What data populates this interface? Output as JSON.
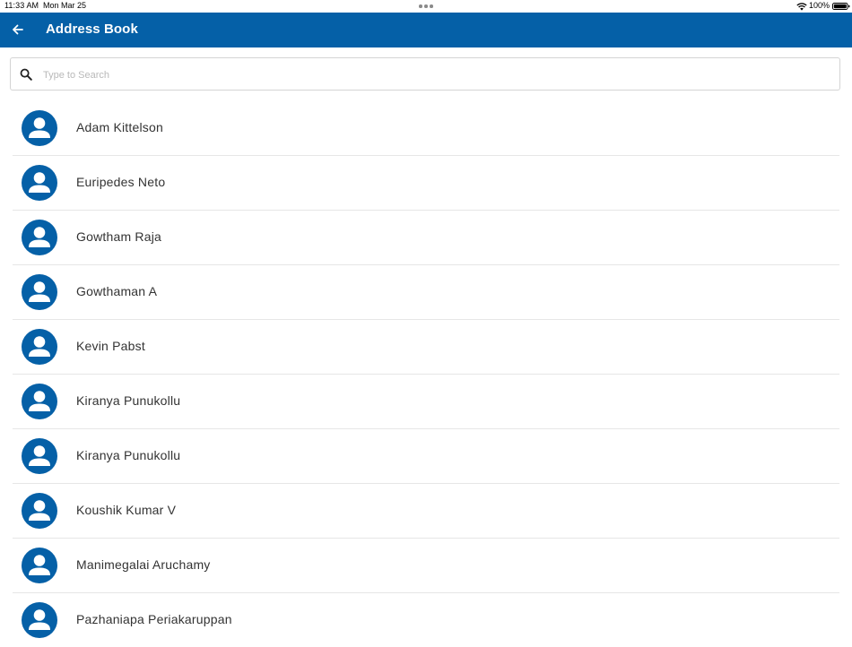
{
  "status_bar": {
    "time": "11:33 AM",
    "date": "Mon Mar 25",
    "battery": "100%"
  },
  "header": {
    "title": "Address Book",
    "back_icon": "arrow-back-icon",
    "background": "#0560a7"
  },
  "search": {
    "placeholder": "Type to Search",
    "value": "",
    "icon": "search-icon"
  },
  "contacts": [
    {
      "name": "Adam Kittelson"
    },
    {
      "name": "Euripedes Neto"
    },
    {
      "name": "Gowtham Raja"
    },
    {
      "name": "Gowthaman A"
    },
    {
      "name": "Kevin Pabst"
    },
    {
      "name": "Kiranya Punukollu"
    },
    {
      "name": "Kiranya Punukollu"
    },
    {
      "name": "Koushik Kumar V"
    },
    {
      "name": "Manimegalai Aruchamy"
    },
    {
      "name": "Pazhaniapa Periakaruppan"
    }
  ],
  "colors": {
    "accent": "#0560a7",
    "avatar": "#0560a7",
    "divider": "#e6e6e6"
  }
}
